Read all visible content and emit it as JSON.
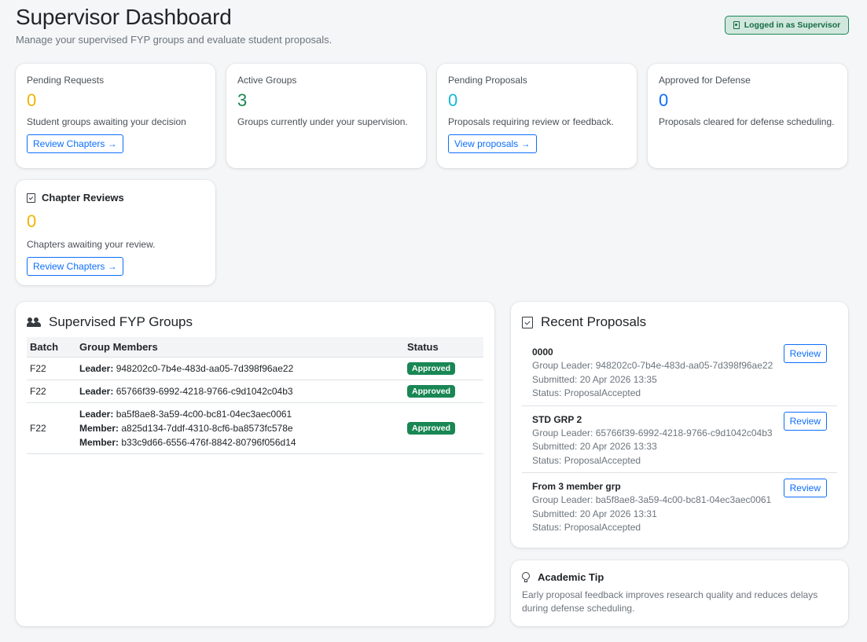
{
  "header": {
    "title": "Supervisor Dashboard",
    "subtitle": "Manage your supervised FYP groups and evaluate student proposals.",
    "login_badge": "Logged in as Supervisor",
    "login_badge_icon": "id-badge-icon"
  },
  "stats": {
    "pending_requests": {
      "label": "Pending Requests",
      "value": "0",
      "description": "Student groups awaiting your decision",
      "button": "Review Chapters →",
      "color": "#f0b400"
    },
    "active_groups": {
      "label": "Active Groups",
      "value": "3",
      "description": "Groups currently under your supervision.",
      "color": "#198754"
    },
    "pending_proposals": {
      "label": "Pending Proposals",
      "value": "0",
      "description": "Proposals requiring review or feedback.",
      "button": "View proposals →",
      "color": "#14b8d4"
    },
    "approved_defense": {
      "label": "Approved for Defense",
      "value": "0",
      "description": "Proposals cleared for defense scheduling.",
      "color": "#0d6efd"
    },
    "chapter_reviews": {
      "label": "Chapter Reviews",
      "icon": "checklist-icon",
      "value": "0",
      "description": "Chapters awaiting your review.",
      "button": "Review Chapters →",
      "color": "#f0b400"
    }
  },
  "groups": {
    "title": "Supervised FYP Groups",
    "icon": "people-icon",
    "columns": [
      "Batch",
      "Group Members",
      "Status"
    ],
    "rows": [
      {
        "batch": "F22",
        "members": [
          {
            "role": "Leader:",
            "id": "948202c0-7b4e-483d-aa05-7d398f96ae22"
          }
        ],
        "status": "Approved"
      },
      {
        "batch": "F22",
        "members": [
          {
            "role": "Leader:",
            "id": "65766f39-6992-4218-9766-c9d1042c04b3"
          }
        ],
        "status": "Approved"
      },
      {
        "batch": "F22",
        "members": [
          {
            "role": "Leader:",
            "id": "ba5f8ae8-3a59-4c00-bc81-04ec3aec0061"
          },
          {
            "role": "Member:",
            "id": "a825d134-7ddf-4310-8cf6-ba8573fc578e"
          },
          {
            "role": "Member:",
            "id": "b33c9d66-6556-476f-8842-80796f056d14"
          }
        ],
        "status": "Approved"
      }
    ],
    "status_color": "#198754"
  },
  "proposals": {
    "title": "Recent Proposals",
    "icon": "checklist-icon",
    "review_label": "Review",
    "items": [
      {
        "title": "0000",
        "leader": "Group Leader: 948202c0-7b4e-483d-aa05-7d398f96ae22",
        "submitted": "Submitted: 20 Apr 2026 13:35",
        "status": "Status: ProposalAccepted"
      },
      {
        "title": "STD GRP 2",
        "leader": "Group Leader: 65766f39-6992-4218-9766-c9d1042c04b3",
        "submitted": "Submitted: 20 Apr 2026 13:33",
        "status": "Status: ProposalAccepted"
      },
      {
        "title": "From 3 member grp",
        "leader": "Group Leader: ba5f8ae8-3a59-4c00-bc81-04ec3aec0061",
        "submitted": "Submitted: 20 Apr 2026 13:31",
        "status": "Status: ProposalAccepted"
      }
    ]
  },
  "tip": {
    "title": "Academic Tip",
    "icon": "lightbulb-icon",
    "text": "Early proposal feedback improves research quality and reduces delays during defense scheduling."
  }
}
